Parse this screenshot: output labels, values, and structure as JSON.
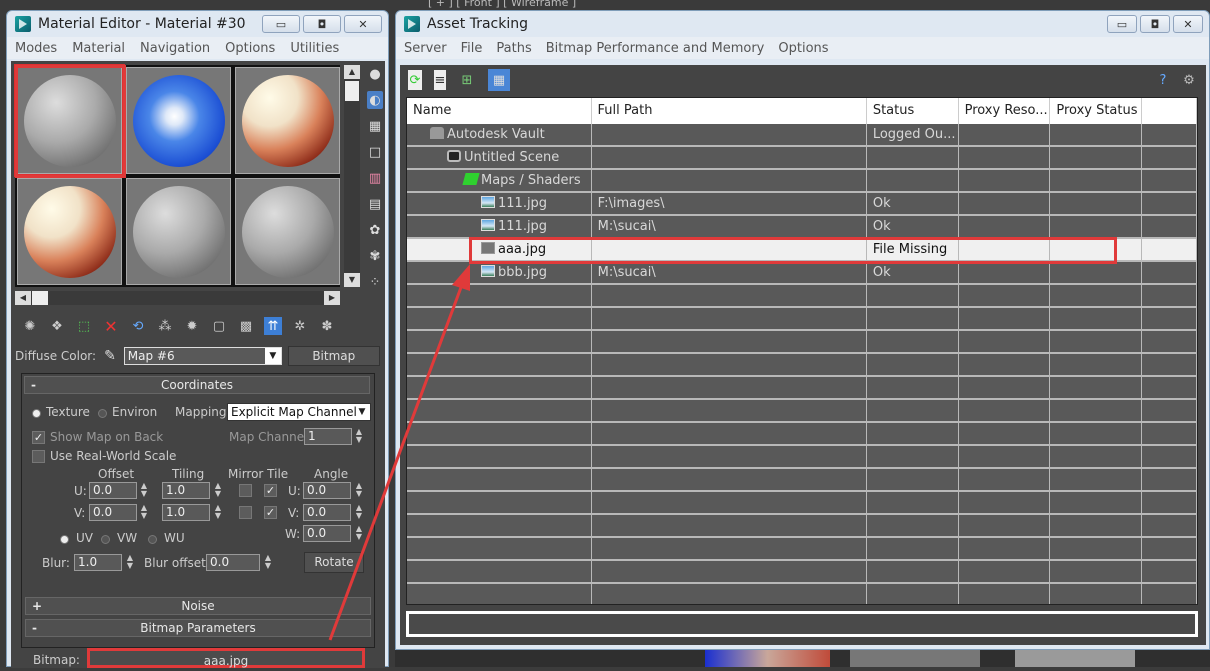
{
  "viewport": {
    "label": "[ + ] [ Front ] [ Wireframe ]"
  },
  "material_editor": {
    "title": "Material Editor - Material #30",
    "window_buttons": [
      "minimize",
      "restore",
      "close"
    ],
    "menu": [
      "Modes",
      "Material",
      "Navigation",
      "Options",
      "Utilities"
    ],
    "slots": [
      {
        "type": "grey",
        "active": true
      },
      {
        "type": "sky",
        "active": false
      },
      {
        "type": "texture",
        "active": false
      },
      {
        "type": "texture",
        "active": false
      },
      {
        "type": "grey",
        "active": false
      },
      {
        "type": "grey",
        "active": false
      }
    ],
    "side_icons": [
      "sample-type-icon",
      "backlight-icon",
      "background-checker-icon",
      "sample-uv-tiling-icon",
      "video-color-check-icon",
      "make-preview-icon",
      "options-icon",
      "select-by-material-icon",
      "material-map-navigator-icon"
    ],
    "toolbar_icons": [
      "get-material-icon",
      "put-to-scene-icon",
      "assign-to-selection-icon",
      "reset-map-icon",
      "make-unique-icon",
      "put-to-library-icon",
      "material-id-channel-icon",
      "show-shaded-material-icon",
      "show-end-result-icon",
      "go-to-parent-icon",
      "go-forward-sibling-icon",
      "pick-material-icon"
    ],
    "diffuse": {
      "label": "Diffuse Color:",
      "map_value": "Map #6",
      "type_button": "Bitmap"
    },
    "coordinates": {
      "title": "Coordinates",
      "collapse": "-",
      "texture_label": "Texture",
      "environ_label": "Environ",
      "mapping_label": "Mapping:",
      "mapping_value": "Explicit Map Channel",
      "show_map_on_back": "Show Map on Back",
      "show_map_on_back_checked": true,
      "real_world_scale": "Use Real-World Scale",
      "real_world_scale_checked": false,
      "map_channel_label": "Map Channel:",
      "map_channel_value": "1",
      "headers": {
        "offset": "Offset",
        "tiling": "Tiling",
        "mirror_tile": "Mirror Tile",
        "angle": "Angle"
      },
      "u_label": "U:",
      "v_label": "V:",
      "w_label": "W:",
      "offset_u": "0.0",
      "offset_v": "0.0",
      "tiling_u": "1.0",
      "tiling_v": "1.0",
      "mirror_u": false,
      "tile_u": true,
      "mirror_v": false,
      "tile_v": true,
      "angle_u": "0.0",
      "angle_v": "0.0",
      "angle_w": "0.0",
      "uv_label": "UV",
      "vw_label": "VW",
      "wu_label": "WU",
      "blur_label": "Blur:",
      "blur_value": "1.0",
      "blur_offset_label": "Blur offset:",
      "blur_offset_value": "0.0",
      "rotate_button": "Rotate"
    },
    "noise": {
      "title": "Noise",
      "expand": "+"
    },
    "bitmap_params": {
      "title": "Bitmap Parameters",
      "collapse": "-",
      "bitmap_label": "Bitmap:",
      "bitmap_value": "aaa.jpg"
    }
  },
  "asset_tracking": {
    "title": "Asset Tracking",
    "menu": [
      "Server",
      "File",
      "Paths",
      "Bitmap Performance and Memory",
      "Options"
    ],
    "toolbar_icons": [
      "refresh-icon",
      "list-view-icon",
      "tree-view-icon",
      "table-view-icon"
    ],
    "help_icons": [
      "help-icon",
      "about-icon"
    ],
    "columns": [
      "Name",
      "Full Path",
      "Status",
      "Proxy Reso...",
      "Proxy Status"
    ],
    "rows": [
      {
        "name": "Autodesk Vault",
        "icon": "vault",
        "indent": 1,
        "path": "",
        "status": "Logged Ou...",
        "highlight": false
      },
      {
        "name": "Untitled Scene",
        "icon": "scene",
        "indent": 2,
        "path": "",
        "status": "",
        "highlight": false
      },
      {
        "name": "Maps / Shaders",
        "icon": "maps",
        "indent": 3,
        "path": "",
        "status": "",
        "highlight": false
      },
      {
        "name": "111.jpg",
        "icon": "img",
        "indent": 4,
        "path": "F:\\images\\",
        "status": "Ok",
        "highlight": false
      },
      {
        "name": "111.jpg",
        "icon": "img",
        "indent": 4,
        "path": "M:\\sucai\\",
        "status": "Ok",
        "highlight": false
      },
      {
        "name": "aaa.jpg",
        "icon": "miss",
        "indent": 4,
        "path": "",
        "status": "File Missing",
        "highlight": true
      },
      {
        "name": "bbb.jpg",
        "icon": "img",
        "indent": 4,
        "path": "M:\\sucai\\",
        "status": "Ok",
        "highlight": false
      }
    ],
    "empty_rows": 14,
    "annotation_color": "#e03a3a"
  }
}
